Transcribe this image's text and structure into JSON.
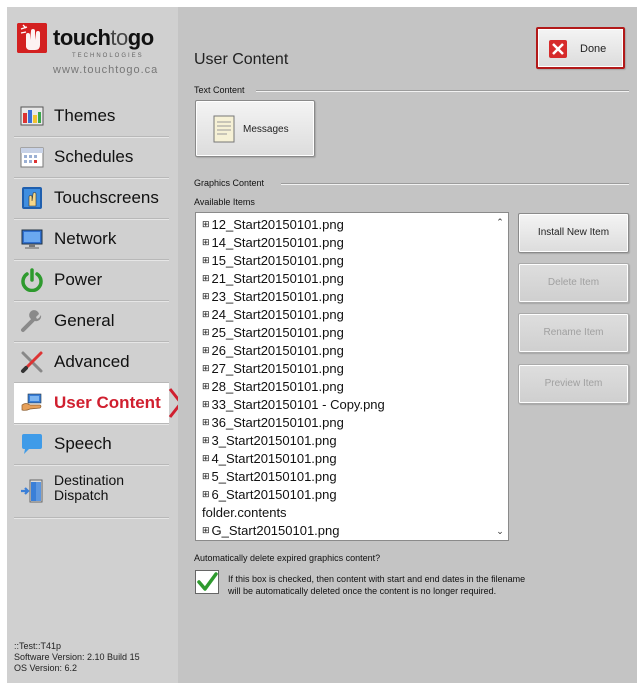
{
  "brand": {
    "name_bold": "touch",
    "name_thin": "to",
    "name_bold2": "go",
    "tagline": "TECHNOLOGIES",
    "url": "www.touchtogo.ca"
  },
  "sidebar": {
    "items": [
      {
        "label": "Themes",
        "icon": "themes-icon"
      },
      {
        "label": "Schedules",
        "icon": "calendar-icon"
      },
      {
        "label": "Touchscreens",
        "icon": "touchscreen-icon"
      },
      {
        "label": "Network",
        "icon": "monitor-icon"
      },
      {
        "label": "Power",
        "icon": "power-icon"
      },
      {
        "label": "General",
        "icon": "wrench-icon"
      },
      {
        "label": "Advanced",
        "icon": "tools-icon"
      },
      {
        "label": "User Content",
        "icon": "user-content-icon",
        "active": true
      },
      {
        "label": "Speech",
        "icon": "speech-bubble-icon"
      },
      {
        "label": "Destination Dispatch",
        "line1": "Destination",
        "line2": "Dispatch",
        "icon": "elevator-icon"
      }
    ]
  },
  "version": {
    "line1": "::Test::T41p",
    "line2": "Software Version: 2.10 Build 15",
    "line3": "OS Version: 6.2"
  },
  "main": {
    "title": "User Content",
    "done_label": "Done",
    "text_content_label": "Text Content",
    "messages_label": "Messages",
    "graphics_content_label": "Graphics Content",
    "available_items_label": "Available Items",
    "items": [
      {
        "label": "12_Start20150101.png",
        "expand": true
      },
      {
        "label": "14_Start20150101.png",
        "expand": true
      },
      {
        "label": "15_Start20150101.png",
        "expand": true
      },
      {
        "label": "21_Start20150101.png",
        "expand": true
      },
      {
        "label": "23_Start20150101.png",
        "expand": true
      },
      {
        "label": "24_Start20150101.png",
        "expand": true
      },
      {
        "label": "25_Start20150101.png",
        "expand": true
      },
      {
        "label": "26_Start20150101.png",
        "expand": true
      },
      {
        "label": "27_Start20150101.png",
        "expand": true
      },
      {
        "label": "28_Start20150101.png",
        "expand": true
      },
      {
        "label": "33_Start20150101 - Copy.png",
        "expand": true
      },
      {
        "label": "36_Start20150101.png",
        "expand": true
      },
      {
        "label": "3_Start20150101.png",
        "expand": true
      },
      {
        "label": "4_Start20150101.png",
        "expand": true
      },
      {
        "label": "5_Start20150101.png",
        "expand": true
      },
      {
        "label": "6_Start20150101.png",
        "expand": true
      },
      {
        "label": "folder.contents",
        "expand": false
      },
      {
        "label": "G_Start20150101.png",
        "expand": true
      }
    ],
    "install_label": "Install New Item",
    "delete_label": "Delete Item",
    "rename_label": "Rename Item",
    "preview_label": "Preview Item",
    "auto_delete_label": "Automatically delete expired graphics content?",
    "auto_delete_checked": true,
    "auto_delete_note_1": "If this box is checked, then content with start and end dates in the filename",
    "auto_delete_note_2": "will be automatically deleted once the content is no longer required."
  },
  "colors": {
    "accent_red": "#d01f2f",
    "check_green": "#2e9a2e",
    "sidebar_bg": "#d0d0d0",
    "main_bg": "#c4c4c4"
  }
}
